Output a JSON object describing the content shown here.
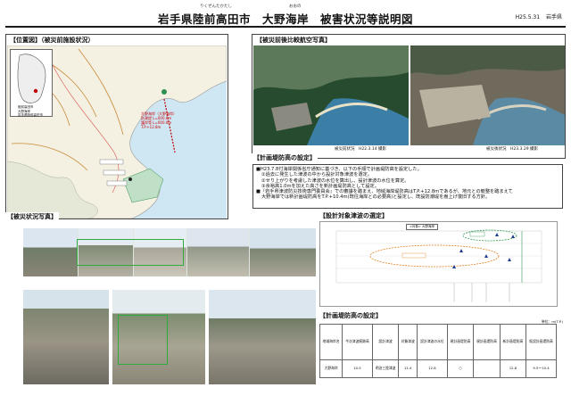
{
  "header": {
    "title": "岩手県陸前高田市　大野海岸　被害状況等説明図",
    "ruby_city": "りくぜんたかたし",
    "ruby_coast": "おおの",
    "date": "H25.5.31",
    "issuer": "岩手県"
  },
  "location": {
    "heading": "【位置図】（被災前施設状況）",
    "mini_label": "大野海岸",
    "mini_caption": [
      "陸前高田市",
      "大野海岸",
      "岩手県陸前高田市"
    ],
    "annotation": [
      "大野海岸（大野海岸）",
      "防潮堤 L=000.0m",
      "護岸等 L=000.0m",
      "T.P.+12.8m"
    ]
  },
  "aerial": {
    "heading": "【被災前後比較航空写真】",
    "before_caption": "被災前状況　H22.3.14 撮影",
    "after_caption": "被災後状況　H23.3.29 撮影"
  },
  "plan_height": {
    "heading": "【計画堤防高の設定】",
    "lines": [
      "■H23.7.8付海岸関係省庁通知に基づき、以下の手順で計画堤防高を設定した。",
      "①過去に発生した津波の中から設計対象津波を選定。",
      "②せり上がりを考慮した津波の水位を算出し、設計津波の水位を算定。",
      "③余裕高1.0mを加えた高さを新計画堤防高として設定。",
      "■『岩手県津波防災技術専門委員会』での審議を踏まえ、地域海岸堤防高はT.P.+12.8mであるが、地元との競整を踏まえて",
      "大野海岸では新計画堤防高をT.P.+10.4m(既往海岸との必要高)と設定し、既設防潮堤を嵩上げ復旧する方針。"
    ]
  },
  "damage_photos": {
    "heading": "【被災状況写真】"
  },
  "tsunami": {
    "heading": "【設計対象津波の選定】",
    "chart_header": "<対象> 大野海岸"
  },
  "plan_table": {
    "heading": "【計画堤防高の設定】",
    "unit": "単位：m(T.P.)",
    "headers": [
      "地域海岸名",
      "今次津波痕跡高",
      "設計津波",
      "対象津波",
      "設計津波の水位",
      "現計画堤防高",
      "現計画堤防高",
      "新計画堤防高",
      "既設計画堤防高"
    ],
    "row": [
      "大野海岸",
      "10.5",
      "明治三陸津波",
      "11.4",
      "12.8",
      "○",
      "",
      "12.8",
      "9.5〜10.4"
    ]
  },
  "colors": {
    "accent": "#c00000",
    "sea": "#cfe6f3",
    "chart_line": "#2f9a55",
    "chart_line2": "#e07f1c",
    "marker": "#1f3d8c"
  }
}
